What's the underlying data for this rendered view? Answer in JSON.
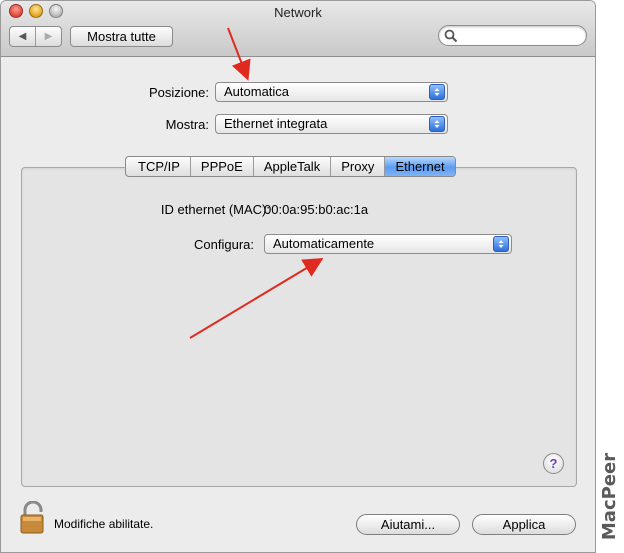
{
  "window": {
    "title": "Network"
  },
  "toolbar": {
    "back_glyph": "◀",
    "forward_glyph": "▶",
    "show_all_label": "Mostra tutte",
    "search_placeholder": ""
  },
  "location": {
    "label": "Posizione:",
    "value": "Automatica"
  },
  "show": {
    "label": "Mostra:",
    "value": "Ethernet integrata"
  },
  "tabs": [
    {
      "label": "TCP/IP",
      "active": false
    },
    {
      "label": "PPPoE",
      "active": false
    },
    {
      "label": "AppleTalk",
      "active": false
    },
    {
      "label": "Proxy",
      "active": false
    },
    {
      "label": "Ethernet",
      "active": true
    }
  ],
  "ethernet": {
    "mac_label": "ID ethernet (MAC):",
    "mac_value": "00:0a:95:b0:ac:1a",
    "configure_label": "Configura:",
    "configure_value": "Automaticamente"
  },
  "help_label": "?",
  "footer": {
    "lock_text": "Modifiche abilitate.",
    "assist_label": "Aiutami...",
    "apply_label": "Applica"
  },
  "watermark": "MacPeer",
  "colors": {
    "accent": "#5b9df2",
    "annotation_arrow": "#e02a1f"
  },
  "icons": [
    "search-icon",
    "lock-icon",
    "help-icon",
    "popup-arrows-icon",
    "back-arrow-icon",
    "forward-arrow-icon"
  ]
}
